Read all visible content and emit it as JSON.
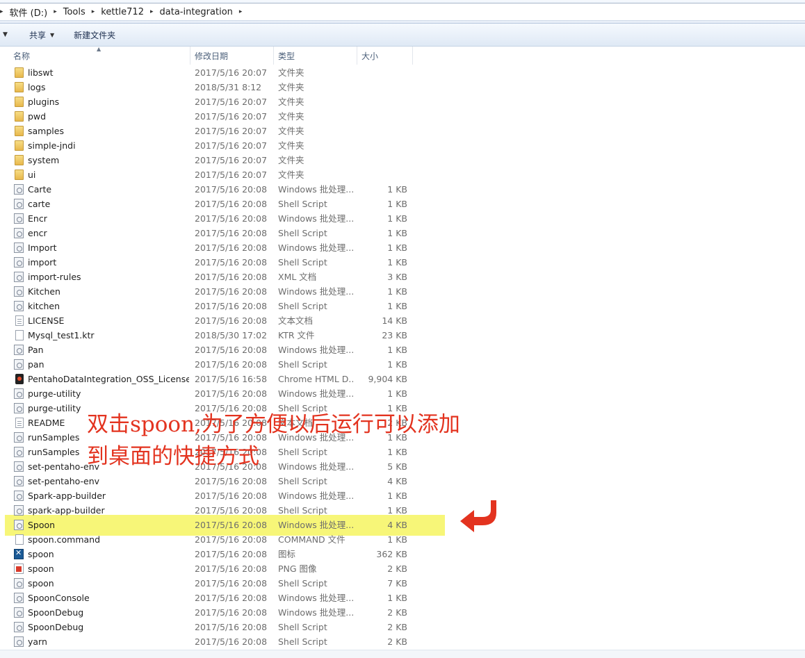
{
  "breadcrumb": {
    "parts": [
      "软件 (D:)",
      "Tools",
      "kettle712",
      "data-integration"
    ]
  },
  "toolbar": {
    "share_label": "共享",
    "new_folder_label": "新建文件夹"
  },
  "columns": {
    "name": "名称",
    "date": "修改日期",
    "type": "类型",
    "size": "大小"
  },
  "files": [
    {
      "name": "libswt",
      "date": "2017/5/16 20:07",
      "type": "文件夹",
      "size": "",
      "icon": "folder-icon"
    },
    {
      "name": "logs",
      "date": "2018/5/31 8:12",
      "type": "文件夹",
      "size": "",
      "icon": "folder-icon"
    },
    {
      "name": "plugins",
      "date": "2017/5/16 20:07",
      "type": "文件夹",
      "size": "",
      "icon": "folder-icon"
    },
    {
      "name": "pwd",
      "date": "2017/5/16 20:07",
      "type": "文件夹",
      "size": "",
      "icon": "folder-icon"
    },
    {
      "name": "samples",
      "date": "2017/5/16 20:07",
      "type": "文件夹",
      "size": "",
      "icon": "folder-icon"
    },
    {
      "name": "simple-jndi",
      "date": "2017/5/16 20:07",
      "type": "文件夹",
      "size": "",
      "icon": "folder-icon"
    },
    {
      "name": "system",
      "date": "2017/5/16 20:07",
      "type": "文件夹",
      "size": "",
      "icon": "folder-icon"
    },
    {
      "name": "ui",
      "date": "2017/5/16 20:07",
      "type": "文件夹",
      "size": "",
      "icon": "folder-icon"
    },
    {
      "name": "Carte",
      "date": "2017/5/16 20:08",
      "type": "Windows 批处理...",
      "size": "1 KB",
      "icon": "batch-file-icon"
    },
    {
      "name": "carte",
      "date": "2017/5/16 20:08",
      "type": "Shell Script",
      "size": "1 KB",
      "icon": "shell-script-icon"
    },
    {
      "name": "Encr",
      "date": "2017/5/16 20:08",
      "type": "Windows 批处理...",
      "size": "1 KB",
      "icon": "batch-file-icon"
    },
    {
      "name": "encr",
      "date": "2017/5/16 20:08",
      "type": "Shell Script",
      "size": "1 KB",
      "icon": "shell-script-icon"
    },
    {
      "name": "Import",
      "date": "2017/5/16 20:08",
      "type": "Windows 批处理...",
      "size": "1 KB",
      "icon": "batch-file-icon"
    },
    {
      "name": "import",
      "date": "2017/5/16 20:08",
      "type": "Shell Script",
      "size": "1 KB",
      "icon": "shell-script-icon"
    },
    {
      "name": "import-rules",
      "date": "2017/5/16 20:08",
      "type": "XML 文档",
      "size": "3 KB",
      "icon": "xml-file-icon"
    },
    {
      "name": "Kitchen",
      "date": "2017/5/16 20:08",
      "type": "Windows 批处理...",
      "size": "1 KB",
      "icon": "batch-file-icon"
    },
    {
      "name": "kitchen",
      "date": "2017/5/16 20:08",
      "type": "Shell Script",
      "size": "1 KB",
      "icon": "shell-script-icon"
    },
    {
      "name": "LICENSE",
      "date": "2017/5/16 20:08",
      "type": "文本文档",
      "size": "14 KB",
      "icon": "text-file-icon"
    },
    {
      "name": "Mysql_test1.ktr",
      "date": "2018/5/30 17:02",
      "type": "KTR 文件",
      "size": "23 KB",
      "icon": "blank-file-icon"
    },
    {
      "name": "Pan",
      "date": "2017/5/16 20:08",
      "type": "Windows 批处理...",
      "size": "1 KB",
      "icon": "batch-file-icon"
    },
    {
      "name": "pan",
      "date": "2017/5/16 20:08",
      "type": "Shell Script",
      "size": "1 KB",
      "icon": "shell-script-icon"
    },
    {
      "name": "PentahoDataIntegration_OSS_Licenses",
      "date": "2017/5/16 16:58",
      "type": "Chrome HTML D...",
      "size": "9,904 KB",
      "icon": "chrome-html-icon"
    },
    {
      "name": "purge-utility",
      "date": "2017/5/16 20:08",
      "type": "Windows 批处理...",
      "size": "1 KB",
      "icon": "batch-file-icon"
    },
    {
      "name": "purge-utility",
      "date": "2017/5/16 20:08",
      "type": "Shell Script",
      "size": "1 KB",
      "icon": "shell-script-icon"
    },
    {
      "name": "README",
      "date": "2017/5/16 20:08",
      "type": "文本文档",
      "size": "2 KB",
      "icon": "text-file-icon"
    },
    {
      "name": "runSamples",
      "date": "2017/5/16 20:08",
      "type": "Windows 批处理...",
      "size": "1 KB",
      "icon": "batch-file-icon"
    },
    {
      "name": "runSamples",
      "date": "2017/5/16 20:08",
      "type": "Shell Script",
      "size": "1 KB",
      "icon": "shell-script-icon"
    },
    {
      "name": "set-pentaho-env",
      "date": "2017/5/16 20:08",
      "type": "Windows 批处理...",
      "size": "5 KB",
      "icon": "batch-file-icon"
    },
    {
      "name": "set-pentaho-env",
      "date": "2017/5/16 20:08",
      "type": "Shell Script",
      "size": "4 KB",
      "icon": "shell-script-icon"
    },
    {
      "name": "Spark-app-builder",
      "date": "2017/5/16 20:08",
      "type": "Windows 批处理...",
      "size": "1 KB",
      "icon": "batch-file-icon"
    },
    {
      "name": "spark-app-builder",
      "date": "2017/5/16 20:08",
      "type": "Shell Script",
      "size": "1 KB",
      "icon": "shell-script-icon"
    },
    {
      "name": "Spoon",
      "date": "2017/5/16 20:08",
      "type": "Windows 批处理...",
      "size": "4 KB",
      "icon": "batch-file-icon",
      "highlighted": true
    },
    {
      "name": "spoon.command",
      "date": "2017/5/16 20:08",
      "type": "COMMAND 文件",
      "size": "1 KB",
      "icon": "blank-file-icon"
    },
    {
      "name": "spoon",
      "date": "2017/5/16 20:08",
      "type": "图标",
      "size": "362 KB",
      "icon": "kettle-icon-file-icon"
    },
    {
      "name": "spoon",
      "date": "2017/5/16 20:08",
      "type": "PNG 图像",
      "size": "2 KB",
      "icon": "png-image-icon"
    },
    {
      "name": "spoon",
      "date": "2017/5/16 20:08",
      "type": "Shell Script",
      "size": "7 KB",
      "icon": "shell-script-icon"
    },
    {
      "name": "SpoonConsole",
      "date": "2017/5/16 20:08",
      "type": "Windows 批处理...",
      "size": "1 KB",
      "icon": "batch-file-icon"
    },
    {
      "name": "SpoonDebug",
      "date": "2017/5/16 20:08",
      "type": "Windows 批处理...",
      "size": "2 KB",
      "icon": "batch-file-icon"
    },
    {
      "name": "SpoonDebug",
      "date": "2017/5/16 20:08",
      "type": "Shell Script",
      "size": "2 KB",
      "icon": "shell-script-icon"
    },
    {
      "name": "yarn",
      "date": "2017/5/16 20:08",
      "type": "Shell Script",
      "size": "2 KB",
      "icon": "shell-script-icon"
    }
  ],
  "annotation": {
    "line1": "双击spoon,为了方便以后运行可以添加",
    "line2": "到桌面的快捷方式",
    "color": "#e3331f"
  },
  "highlight_color": "#f6f560"
}
